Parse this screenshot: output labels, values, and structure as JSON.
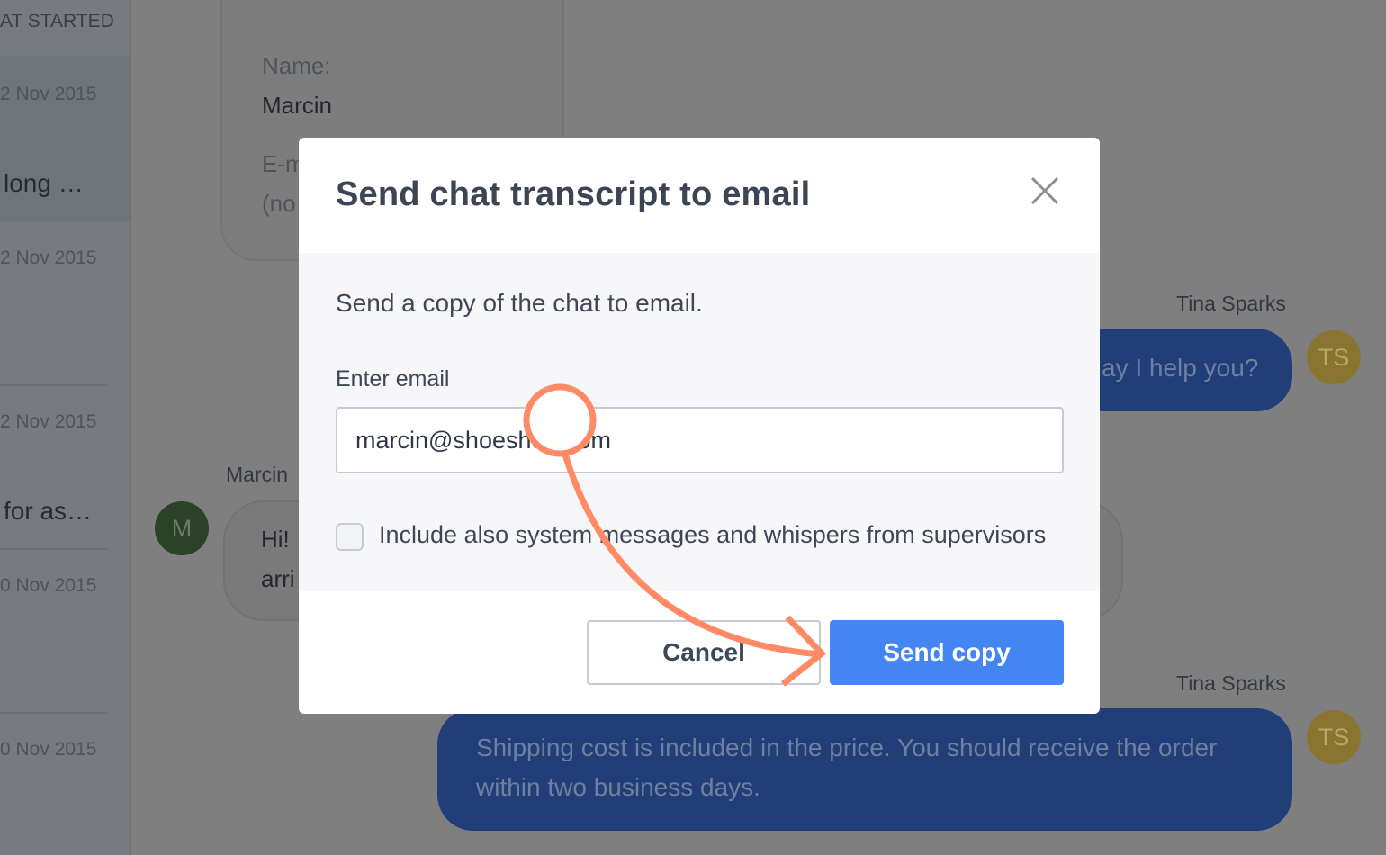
{
  "sidebar": {
    "header": "AT STARTED",
    "items": [
      {
        "date": "2 Nov 2015",
        "preview": "long …"
      },
      {
        "date": "2 Nov 2015",
        "preview": ""
      },
      {
        "date": "2 Nov 2015",
        "preview": "for as…"
      },
      {
        "date": "0 Nov 2015",
        "preview": ""
      },
      {
        "date": "0 Nov 2015",
        "preview": ""
      }
    ]
  },
  "visitor_card": {
    "name_label": "Name:",
    "name_value": "Marcin",
    "email_label": "E-m",
    "email_value": "(no"
  },
  "chat": {
    "messages": [
      {
        "author": "Tina Sparks",
        "initials": "TS",
        "text": "ay I help you?",
        "avatar_color": "#8a7530"
      },
      {
        "author": "Marcin",
        "initials": "M",
        "text_line1": "Hi!",
        "text_line2": "arri",
        "avatar_color": "#2b4128"
      },
      {
        "author": "Tina Sparks",
        "initials": "TS",
        "text": "Shipping cost is included in the price. You should receive the order within two business days.",
        "avatar_color": "#8a7530"
      }
    ]
  },
  "modal": {
    "title": "Send chat transcript to email",
    "description": "Send a copy of the chat to email.",
    "email_label": "Enter email",
    "email_value": "marcin@shoeshop.com",
    "checkbox_label": "Include also system messages and whispers from supervisors",
    "checkbox_checked": false,
    "cancel_label": "Cancel",
    "send_label": "Send copy"
  },
  "colors": {
    "accent": "#4385f2",
    "annotation": "#ff8a65"
  }
}
